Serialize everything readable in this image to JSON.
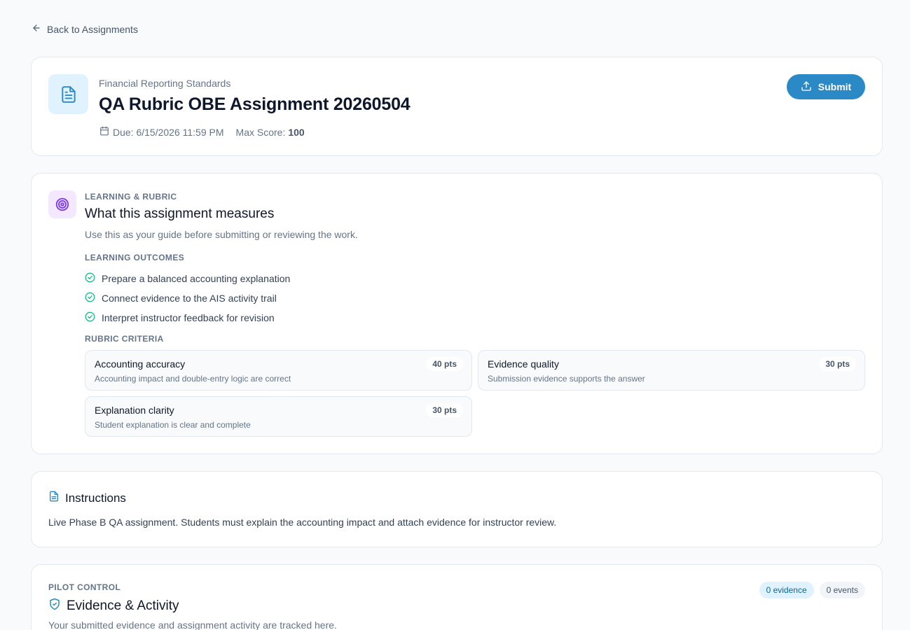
{
  "nav": {
    "back_label": "Back to Assignments"
  },
  "assignment": {
    "course": "Financial Reporting Standards",
    "title": "QA Rubric OBE Assignment 20260504",
    "due_label": "Due: 6/15/2026 11:59 PM",
    "max_score_label": "Max Score:",
    "max_score_value": "100",
    "submit_label": "Submit"
  },
  "rubric": {
    "eyebrow": "LEARNING & RUBRIC",
    "title": "What this assignment measures",
    "subtitle": "Use this as your guide before submitting or reviewing the work.",
    "outcomes_label": "LEARNING OUTCOMES",
    "outcomes": [
      "Prepare a balanced accounting explanation",
      "Connect evidence to the AIS activity trail",
      "Interpret instructor feedback for revision"
    ],
    "criteria_label": "RUBRIC CRITERIA",
    "criteria": [
      {
        "name": "Accounting accuracy",
        "description": "Accounting impact and double-entry logic are correct",
        "points": "40 pts"
      },
      {
        "name": "Evidence quality",
        "description": "Submission evidence supports the answer",
        "points": "30 pts"
      },
      {
        "name": "Explanation clarity",
        "description": "Student explanation is clear and complete",
        "points": "30 pts"
      }
    ]
  },
  "instructions": {
    "title": "Instructions",
    "body": "Live Phase B QA assignment. Students must explain the accounting impact and attach evidence for instructor review."
  },
  "evidence": {
    "eyebrow": "PILOT CONTROL",
    "title": "Evidence & Activity",
    "subtitle": "Your submitted evidence and assignment activity are tracked here.",
    "evidence_count": "0 evidence",
    "events_count": "0 events"
  },
  "icons": {
    "back": "arrow-left-icon",
    "assignment": "file-text-icon",
    "calendar": "calendar-icon",
    "submit": "upload-icon",
    "rubric": "target-icon",
    "outcome": "check-circle-icon",
    "instructions": "file-text-icon",
    "evidence": "shield-check-icon"
  },
  "colors": {
    "accent": "#2b8ac6",
    "success": "#10b981",
    "purple": "#7c3aed",
    "background": "#f8fafc"
  }
}
